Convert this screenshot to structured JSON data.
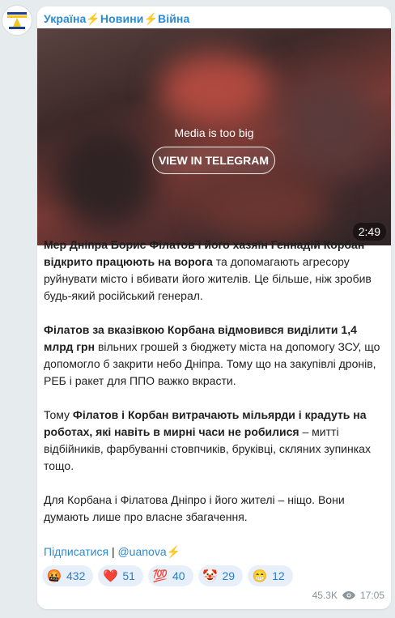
{
  "channel": {
    "title": "Україна⚡Новини⚡Війна"
  },
  "media": {
    "notice": "Media is too big",
    "button_label": "VIEW IN TELEGRAM",
    "duration": "2:49"
  },
  "post": {
    "p1_b1": "Мер Дніпра Борис Філатов і його хазяїн Геннадій Корбан відкрито працюють на ворога",
    "p1_t1": " та допомагають агресору руйнувати місто і вбивати його жителів. Це більше, ніж зробив будь-який російський генерал.",
    "p2_b1": "Філатов за вказівкою Корбана відмовився виділити 1,4 млрд грн",
    "p2_t1": " вільних грошей з бюджету міста на допомогу ЗСУ, що допомогло б закрити небо Дніпра. Тому що на закупівлі дронів, РЕБ і ракет для ППО важко вкрасти.",
    "p3_t1": "Тому ",
    "p3_b1": "Філатов і Корбан витрачають мільярди і крадуть на роботах, які навіть в мирні часи не робилися",
    "p3_t2": " – митті відбійників, фарбуванні стовпчиків, бруківці, скляних зупинках тощо.",
    "p4_t1": "Для Корбана і Філатова Дніпро і його жителі – ніщо. Вони думають лише про власне збагачення."
  },
  "links": {
    "subscribe": "Підписатися",
    "separator": "|",
    "handle": "@uanova⚡"
  },
  "reactions": [
    {
      "emoji": "🤬",
      "count": "432"
    },
    {
      "emoji": "❤️",
      "count": "51"
    },
    {
      "emoji": "💯",
      "count": "40"
    },
    {
      "emoji": "🤡",
      "count": "29"
    },
    {
      "emoji": "😁",
      "count": "12"
    }
  ],
  "meta": {
    "views": "45.3K",
    "time": "17:05"
  },
  "colors": {
    "accent": "#2a8bd3",
    "reaction_bg": "#e7f0fa",
    "background": "#e6ebee"
  }
}
